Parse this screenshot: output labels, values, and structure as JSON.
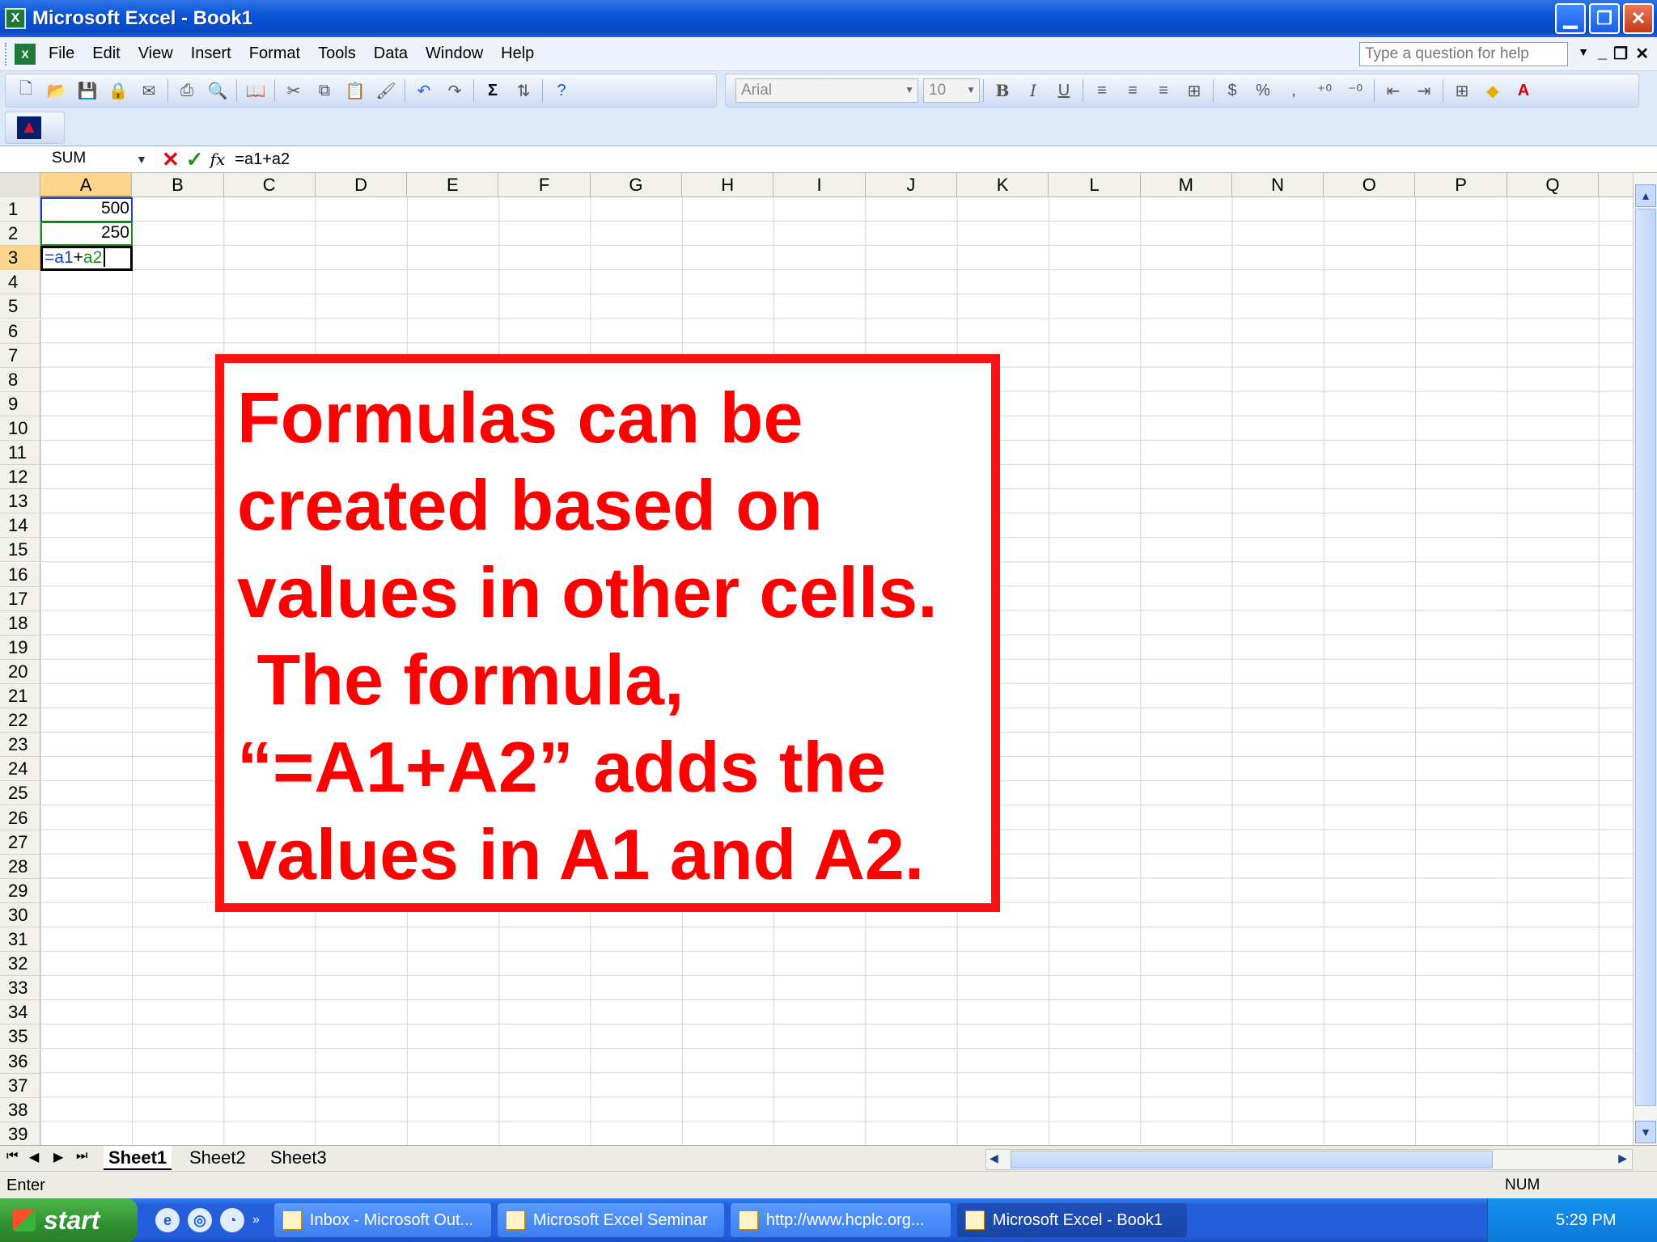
{
  "window": {
    "title": "Microsoft Excel - Book1",
    "app_icon": "X"
  },
  "menu": {
    "items": [
      "File",
      "Edit",
      "View",
      "Insert",
      "Format",
      "Tools",
      "Data",
      "Window",
      "Help"
    ],
    "help_placeholder": "Type a question for help"
  },
  "toolbar": {
    "font": "Arial",
    "size": "10",
    "bold": "B",
    "italic": "I",
    "underline": "U",
    "currency": "$",
    "percent": "%",
    "comma": ",",
    "sigma": "Σ"
  },
  "formula_bar": {
    "name_box": "SUM",
    "fx": "fx",
    "formula": "=a1+a2"
  },
  "columns": [
    "A",
    "B",
    "C",
    "D",
    "E",
    "F",
    "G",
    "H",
    "I",
    "J",
    "K",
    "L",
    "M",
    "N",
    "O",
    "P",
    "Q"
  ],
  "active_column": "A",
  "rows": [
    "1",
    "2",
    "3",
    "4",
    "5",
    "6",
    "7",
    "8",
    "9",
    "10",
    "11",
    "12",
    "13",
    "14",
    "15",
    "16",
    "17",
    "18",
    "19",
    "20",
    "21",
    "22",
    "23",
    "24",
    "25",
    "26",
    "27",
    "28",
    "29",
    "30",
    "31",
    "32",
    "33",
    "34",
    "35",
    "36",
    "37",
    "38",
    "39"
  ],
  "active_row": "3",
  "cells": {
    "a1": "500",
    "a2": "250",
    "a3_edit_1": "=a1",
    "a3_edit_2": "+",
    "a3_edit_3": "a2"
  },
  "callout": {
    "lines": [
      "Formulas can be",
      "created based on",
      "values in other cells.",
      " The formula,",
      "“=A1+A2” adds the",
      "values in A1 and A2."
    ]
  },
  "sheets": {
    "tabs": [
      "Sheet1",
      "Sheet2",
      "Sheet3"
    ],
    "active": "Sheet1"
  },
  "status": {
    "mode": "Enter",
    "num": "NUM"
  },
  "taskbar": {
    "start": "start",
    "buttons": [
      "Inbox - Microsoft Out...",
      "Microsoft Excel Seminar",
      "http://www.hcplc.org...",
      "Microsoft Excel - Book1"
    ],
    "clock": "5:29 PM"
  },
  "colors": {
    "callout": "#ff0000",
    "ref1_border": "#1d3fd2",
    "ref2_border": "#1d8a1d",
    "active_header": "#fbd68c"
  }
}
